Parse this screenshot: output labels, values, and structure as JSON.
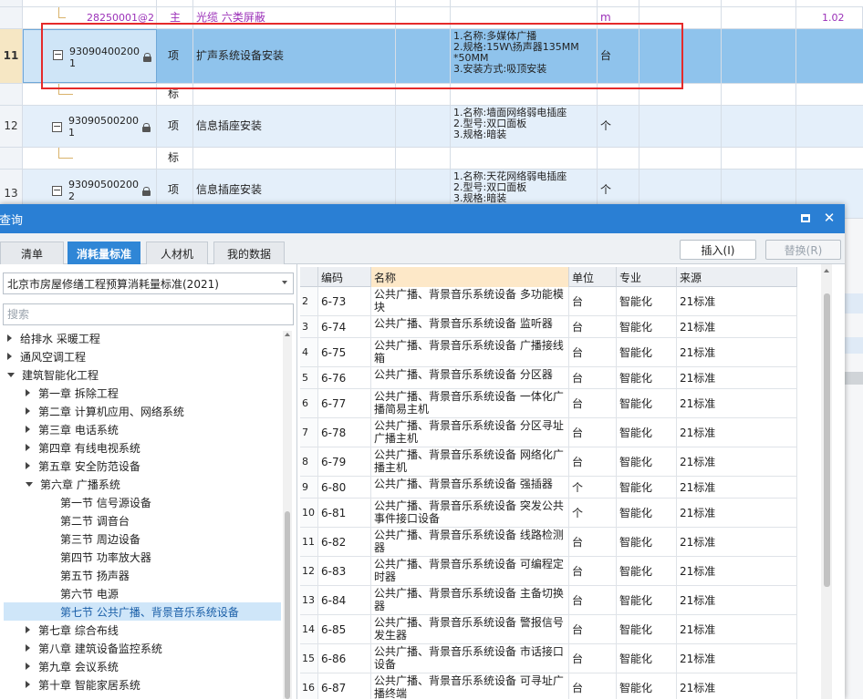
{
  "grid": {
    "top_row": {
      "code": "28250001@2",
      "type": "主",
      "name": "光缆 六类屏蔽",
      "unit": "m",
      "quantity": "1.02"
    },
    "rows": [
      {
        "num": "11",
        "code": "93090400200\n1",
        "type": "项",
        "name": "扩声系统设备安装",
        "features": "1.名称:多媒体广播\n2.规格:15W\\扬声器135MM\n*50MM\n3.安装方式:吸顶安装",
        "unit": "台"
      },
      {
        "sub_type": "标"
      },
      {
        "num": "12",
        "code": "93090500200\n1",
        "type": "项",
        "name": "信息插座安装",
        "features": "1.名称:墙面网络弱电插座\n2.型号:双口面板\n3.规格:暗装",
        "unit": "个"
      },
      {
        "sub_type": "标"
      },
      {
        "num": "13",
        "code": "93090500200\n2",
        "type": "项",
        "name": "信息插座安装",
        "features": "1.名称:天花网络弱电插座\n2.型号:双口面板\n3.规格:暗装",
        "unit": "个"
      }
    ]
  },
  "dialog": {
    "title": "查询",
    "tabs": [
      {
        "label": "清单"
      },
      {
        "label": "消耗量标准"
      },
      {
        "label": "人材机"
      },
      {
        "label": "我的数据"
      }
    ],
    "insert_label": "插入(I)",
    "replace_label": "替换(R)",
    "standard": "北京市房屋修缮工程预算消耗量标准(2021)",
    "search_placeholder": "搜索",
    "tree": [
      {
        "label": "给排水 采暖工程"
      },
      {
        "label": "通风空调工程"
      },
      {
        "label": "建筑智能化工程"
      },
      {
        "label": "第一章 拆除工程"
      },
      {
        "label": "第二章 计算机应用、网络系统"
      },
      {
        "label": "第三章 电话系统"
      },
      {
        "label": "第四章 有线电视系统"
      },
      {
        "label": "第五章 安全防范设备"
      },
      {
        "label": "第六章 广播系统"
      },
      {
        "label": "第一节 信号源设备"
      },
      {
        "label": "第二节 调音台"
      },
      {
        "label": "第三节 周边设备"
      },
      {
        "label": "第四节 功率放大器"
      },
      {
        "label": "第五节 扬声器"
      },
      {
        "label": "第六节 电源"
      },
      {
        "label": "第七节 公共广播、背景音乐系统设备"
      },
      {
        "label": "第七章 综合布线"
      },
      {
        "label": "第八章 建筑设备监控系统"
      },
      {
        "label": "第九章 会议系统"
      },
      {
        "label": "第十章 智能家居系统"
      }
    ],
    "table": {
      "columns": [
        "编码",
        "名称",
        "单位",
        "专业",
        "来源"
      ],
      "rows": [
        {
          "idx": "2",
          "code": "6-73",
          "name": "公共广播、背景音乐系统设备 多功能模块",
          "unit": "台",
          "major": "智能化",
          "source": "21标准"
        },
        {
          "idx": "3",
          "code": "6-74",
          "name": "公共广播、背景音乐系统设备 监听器",
          "unit": "台",
          "major": "智能化",
          "source": "21标准"
        },
        {
          "idx": "4",
          "code": "6-75",
          "name": "公共广播、背景音乐系统设备 广播接线箱",
          "unit": "台",
          "major": "智能化",
          "source": "21标准"
        },
        {
          "idx": "5",
          "code": "6-76",
          "name": "公共广播、背景音乐系统设备 分区器",
          "unit": "台",
          "major": "智能化",
          "source": "21标准"
        },
        {
          "idx": "6",
          "code": "6-77",
          "name": "公共广播、背景音乐系统设备 一体化广播简易主机",
          "unit": "台",
          "major": "智能化",
          "source": "21标准"
        },
        {
          "idx": "7",
          "code": "6-78",
          "name": "公共广播、背景音乐系统设备 分区寻址广播主机",
          "unit": "台",
          "major": "智能化",
          "source": "21标准"
        },
        {
          "idx": "8",
          "code": "6-79",
          "name": "公共广播、背景音乐系统设备 网络化广播主机",
          "unit": "台",
          "major": "智能化",
          "source": "21标准"
        },
        {
          "idx": "9",
          "code": "6-80",
          "name": "公共广播、背景音乐系统设备 强插器",
          "unit": "个",
          "major": "智能化",
          "source": "21标准"
        },
        {
          "idx": "10",
          "code": "6-81",
          "name": "公共广播、背景音乐系统设备 突发公共事件接口设备",
          "unit": "个",
          "major": "智能化",
          "source": "21标准"
        },
        {
          "idx": "11",
          "code": "6-82",
          "name": "公共广播、背景音乐系统设备 线路检测器",
          "unit": "台",
          "major": "智能化",
          "source": "21标准"
        },
        {
          "idx": "12",
          "code": "6-83",
          "name": "公共广播、背景音乐系统设备 可编程定时器",
          "unit": "台",
          "major": "智能化",
          "source": "21标准"
        },
        {
          "idx": "13",
          "code": "6-84",
          "name": "公共广播、背景音乐系统设备 主备切换器",
          "unit": "台",
          "major": "智能化",
          "source": "21标准"
        },
        {
          "idx": "14",
          "code": "6-85",
          "name": "公共广播、背景音乐系统设备 警报信号发生器",
          "unit": "台",
          "major": "智能化",
          "source": "21标准"
        },
        {
          "idx": "15",
          "code": "6-86",
          "name": "公共广播、背景音乐系统设备 市话接口设备",
          "unit": "台",
          "major": "智能化",
          "source": "21标准"
        },
        {
          "idx": "16",
          "code": "6-87",
          "name": "公共广播、背景音乐系统设备 可寻址广播终端",
          "unit": "台",
          "major": "智能化",
          "source": "21标准"
        }
      ]
    }
  },
  "colors": {
    "title_bar": "#2a7fd4",
    "active_tab": "#2f86d6",
    "selected_row": "#8fc3ec",
    "highlight_box": "#e52a2a",
    "name_header": "#fde8c8"
  }
}
